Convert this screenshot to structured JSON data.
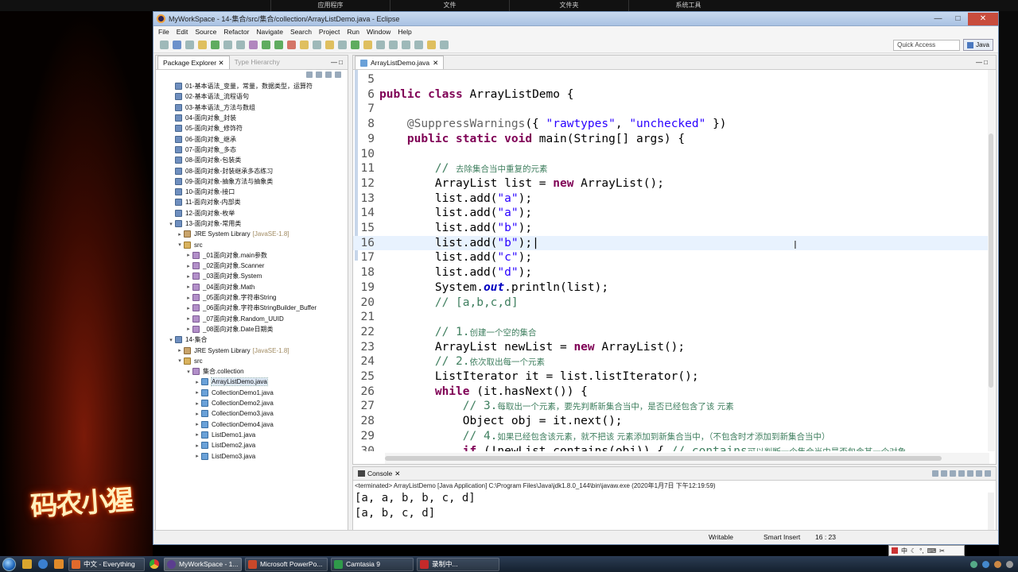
{
  "desktop": {
    "top_labels": [
      "应用程序",
      "文件",
      "文件夹",
      "系统工具"
    ],
    "logo_text": "码农小猩"
  },
  "window": {
    "title": "MyWorkSpace - 14-集合/src/集合/collection/ArrayListDemo.java - Eclipse",
    "menu": [
      "File",
      "Edit",
      "Source",
      "Refactor",
      "Navigate",
      "Search",
      "Project",
      "Run",
      "Window",
      "Help"
    ],
    "quick_access_placeholder": "Quick Access",
    "perspective": "Java"
  },
  "package_explorer": {
    "tab_label": "Package Explorer",
    "inactive_tab": "Type Hierarchy",
    "tree": [
      {
        "label": "01-基本语法_变量，常量，数据类型，运算符",
        "icon": "proj",
        "indent": 0,
        "twisty": ""
      },
      {
        "label": "02-基本语法_流程语句",
        "icon": "proj",
        "indent": 0,
        "twisty": ""
      },
      {
        "label": "03-基本语法_方法与数组",
        "icon": "proj",
        "indent": 0,
        "twisty": ""
      },
      {
        "label": "04-面向对象_封装",
        "icon": "proj",
        "indent": 0,
        "twisty": ""
      },
      {
        "label": "05-面向对象_修饰符",
        "icon": "proj",
        "indent": 0,
        "twisty": ""
      },
      {
        "label": "06-面向对象_继承",
        "icon": "proj",
        "indent": 0,
        "twisty": ""
      },
      {
        "label": "07-面向对象_多态",
        "icon": "proj",
        "indent": 0,
        "twisty": ""
      },
      {
        "label": "08-面向对象-包装类",
        "icon": "proj",
        "indent": 0,
        "twisty": ""
      },
      {
        "label": "08-面向对象-封装继承多态练习",
        "icon": "proj",
        "indent": 0,
        "twisty": ""
      },
      {
        "label": "09-面向对象-抽象方法与抽象类",
        "icon": "proj",
        "indent": 0,
        "twisty": ""
      },
      {
        "label": "10-面向对象-接口",
        "icon": "proj",
        "indent": 0,
        "twisty": ""
      },
      {
        "label": "11-面向对象-内部类",
        "icon": "proj",
        "indent": 0,
        "twisty": ""
      },
      {
        "label": "12-面向对象-枚举",
        "icon": "proj",
        "indent": 0,
        "twisty": ""
      },
      {
        "label": "13-面向对象-常用类",
        "icon": "proj",
        "indent": 0,
        "twisty": "▾"
      },
      {
        "label": "JRE System Library",
        "sub": "[JavaSE-1.8]",
        "icon": "lib",
        "indent": 1,
        "twisty": "▸"
      },
      {
        "label": "src",
        "icon": "src",
        "indent": 1,
        "twisty": "▾"
      },
      {
        "label": "_01面向对象.main参数",
        "icon": "pkg",
        "indent": 2,
        "twisty": "▸"
      },
      {
        "label": "_02面向对象.Scanner",
        "icon": "pkg",
        "indent": 2,
        "twisty": "▸"
      },
      {
        "label": "_03面向对象.System",
        "icon": "pkg",
        "indent": 2,
        "twisty": "▸"
      },
      {
        "label": "_04面向对象.Math",
        "icon": "pkg",
        "indent": 2,
        "twisty": "▸"
      },
      {
        "label": "_05面向对象.字符串String",
        "icon": "pkg",
        "indent": 2,
        "twisty": "▸"
      },
      {
        "label": "_06面向对象.字符串StringBuilder_Buffer",
        "icon": "pkg",
        "indent": 2,
        "twisty": "▸"
      },
      {
        "label": "_07面向对象.Random_UUID",
        "icon": "pkg",
        "indent": 2,
        "twisty": "▸"
      },
      {
        "label": "_08面向对象.Date日期类",
        "icon": "pkg",
        "indent": 2,
        "twisty": "▸"
      },
      {
        "label": "14-集合",
        "icon": "proj",
        "indent": 0,
        "twisty": "▾"
      },
      {
        "label": "JRE System Library",
        "sub": "[JavaSE-1.8]",
        "icon": "lib",
        "indent": 1,
        "twisty": "▸"
      },
      {
        "label": "src",
        "icon": "src",
        "indent": 1,
        "twisty": "▾"
      },
      {
        "label": "集合.collection",
        "icon": "pkg",
        "indent": 2,
        "twisty": "▾"
      },
      {
        "label": "ArrayListDemo.java",
        "icon": "java",
        "indent": 3,
        "twisty": "▸",
        "selected": true
      },
      {
        "label": "CollectionDemo1.java",
        "icon": "java",
        "indent": 3,
        "twisty": "▸"
      },
      {
        "label": "CollectionDemo2.java",
        "icon": "java",
        "indent": 3,
        "twisty": "▸"
      },
      {
        "label": "CollectionDemo3.java",
        "icon": "java",
        "indent": 3,
        "twisty": "▸"
      },
      {
        "label": "CollectionDemo4.java",
        "icon": "java",
        "indent": 3,
        "twisty": "▸"
      },
      {
        "label": "ListDemo1.java",
        "icon": "java",
        "indent": 3,
        "twisty": "▸"
      },
      {
        "label": "ListDemo2.java",
        "icon": "java",
        "indent": 3,
        "twisty": "▸"
      },
      {
        "label": "ListDemo3.java",
        "icon": "java",
        "indent": 3,
        "twisty": "▸"
      }
    ]
  },
  "editor": {
    "tab_label": "ArrayListDemo.java",
    "current_line": 16,
    "lines": [
      {
        "n": "5",
        "html": ""
      },
      {
        "n": "6",
        "html": "<span class='kw'>public class</span> ArrayListDemo {"
      },
      {
        "n": "7",
        "html": ""
      },
      {
        "n": "8",
        "html": "    <span class='ann'>@SuppressWarnings</span>({ <span class='str'>\"rawtypes\"</span>, <span class='str'>\"unchecked\"</span> })"
      },
      {
        "n": "9",
        "html": "    <span class='kw'>public static void</span> main(String[] args) {"
      },
      {
        "n": "10",
        "html": ""
      },
      {
        "n": "11",
        "html": "        <span class='cm'>// </span><span class='cm-zh'>去除集合当中重复的元素</span>"
      },
      {
        "n": "12",
        "html": "        ArrayList list = <span class='kw'>new</span> ArrayList();"
      },
      {
        "n": "13",
        "html": "        list.add(<span class='str'>\"a\"</span>);"
      },
      {
        "n": "14",
        "html": "        list.add(<span class='str'>\"a\"</span>);"
      },
      {
        "n": "15",
        "html": "        list.add(<span class='str'>\"b\"</span>);"
      },
      {
        "n": "16",
        "html": "        list.add(<span class='str'>\"b\"</span>);|"
      },
      {
        "n": "17",
        "html": "        list.add(<span class='str'>\"c\"</span>);"
      },
      {
        "n": "18",
        "html": "        list.add(<span class='str'>\"d\"</span>);"
      },
      {
        "n": "19",
        "html": "        System.<span class='fld'>out</span>.println(list);"
      },
      {
        "n": "20",
        "html": "        <span class='cm'>// [a,b,c,d]</span>"
      },
      {
        "n": "21",
        "html": ""
      },
      {
        "n": "22",
        "html": "        <span class='cm'>// 1.</span><span class='cm-zh'>创建一个空的集合</span>"
      },
      {
        "n": "23",
        "html": "        ArrayList newList = <span class='kw'>new</span> ArrayList();"
      },
      {
        "n": "24",
        "html": "        <span class='cm'>// 2.</span><span class='cm-zh'>依次取出每一个元素</span>"
      },
      {
        "n": "25",
        "html": "        ListIterator it = list.listIterator();"
      },
      {
        "n": "26",
        "html": "        <span class='kw'>while</span> (it.hasNext()) {"
      },
      {
        "n": "27",
        "html": "            <span class='cm'>// 3.</span><span class='cm-zh'>每取出一个元素，要先判断新集合当中，是否已经包含了该 元素</span>"
      },
      {
        "n": "28",
        "html": "            Object obj = it.next();"
      },
      {
        "n": "29",
        "html": "            <span class='cm'>// 4.</span><span class='cm-zh'>如果已经包含该元素，就不把该 元素添加到新集合当中，（不包含时才添加到新集合当中）</span>"
      },
      {
        "n": "30",
        "html": "            <span class='kw'>if</span> (!newList.contains(obj)) { <span class='cm'>// contains</span><span class='cm-zh'>可以判断一个集合当中是否包含某一个对象</span>"
      }
    ]
  },
  "console": {
    "tab_label": "Console",
    "terminated": "<terminated> ArrayListDemo [Java Application] C:\\Program Files\\Java\\jdk1.8.0_144\\bin\\javaw.exe (2020年1月7日 下午12:19:59)",
    "output": [
      "[a, a, b, b, c, d]",
      "[a, b, c, d]"
    ]
  },
  "status": {
    "writable": "Writable",
    "insert_mode": "Smart Insert",
    "position": "16 : 23"
  },
  "taskbar": {
    "items": [
      {
        "label": "中文 - Everything",
        "color": "#e26a2c"
      },
      {
        "label": "MyWorkSpace - 1...",
        "color": "#5b3e8f",
        "active": true
      },
      {
        "label": "Microsoft PowerPo...",
        "color": "#c8482a"
      },
      {
        "label": "Camtasia 9",
        "color": "#2f9a4a"
      },
      {
        "label": "录制中...",
        "color": "#c42a2a"
      }
    ],
    "ime": "中"
  }
}
